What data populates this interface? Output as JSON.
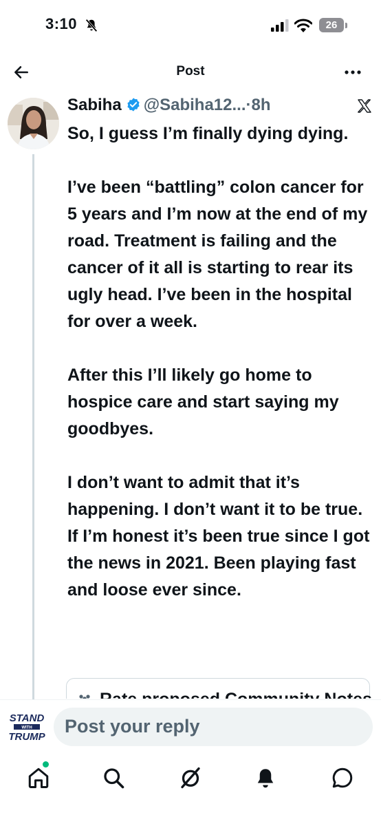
{
  "status_bar": {
    "time": "3:10",
    "battery": "26"
  },
  "header": {
    "title": "Post"
  },
  "post": {
    "author_name": "Sabiha",
    "author_handle": "@Sabiha12...",
    "separator": "·",
    "time": "8h",
    "paragraphs": [
      "So, I guess I’m finally dying dying.",
      "I’ve been “battling” colon cancer for 5 years and I’m now at the end of my road. Treatment is failing and the cancer of it all is starting to rear its ugly head. I’ve been in the hospital for over a week.",
      "After this I’ll likely go home to hospice care and start saying my goodbyes.",
      "I don’t want to admit that it’s happening. I don’t want it to be true. If I’m honest it’s been true since I got the news in 2021. Been playing fast and loose ever since."
    ]
  },
  "community_note": {
    "label": "Rate proposed Community Notes"
  },
  "reply": {
    "placeholder": "Post your reply",
    "avatar_text": {
      "top": "STAND",
      "middle": "WITH",
      "bottom": "TRUMP"
    }
  },
  "nav": {
    "items": [
      {
        "icon": "home-icon",
        "active": true,
        "notification_dot": true
      },
      {
        "icon": "search-icon"
      },
      {
        "icon": "grok-icon"
      },
      {
        "icon": "bell-icon"
      },
      {
        "icon": "chat-icon"
      }
    ]
  },
  "colors": {
    "text": "#0f1419",
    "secondary": "#536471",
    "verified": "#1d9bf0",
    "input_bg": "#eff3f4",
    "notification_dot": "#00ba7c"
  }
}
